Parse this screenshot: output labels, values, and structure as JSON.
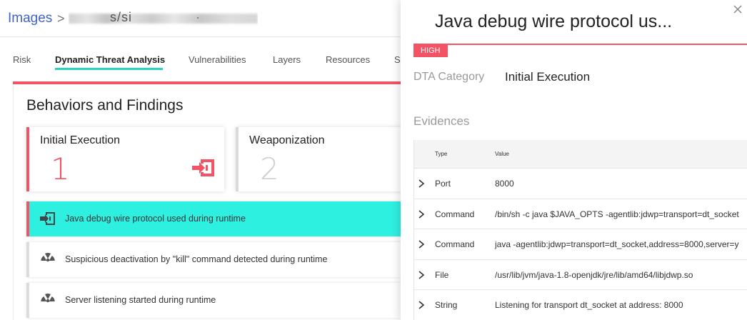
{
  "breadcrumb": {
    "root": "Images",
    "separator": ">",
    "path_fragment": "s/si",
    "path_fragment2": "·"
  },
  "tabs": [
    {
      "label": "Risk"
    },
    {
      "label": "Dynamic Threat Analysis",
      "active": true
    },
    {
      "label": "Vulnerabilities"
    },
    {
      "label": "Layers"
    },
    {
      "label": "Resources"
    },
    {
      "label": "S"
    }
  ],
  "main": {
    "section_title": "Behaviors and Findings",
    "categories": [
      {
        "name": "Initial Execution",
        "count": "1",
        "icon": "enter-icon"
      },
      {
        "name": "Weaponization",
        "count": "2"
      }
    ],
    "findings": [
      {
        "text": "Java debug wire protocol used during runtime",
        "icon": "enter-icon",
        "selected": true
      },
      {
        "text": "Suspicious deactivation by \"kill\" command detected during runtime",
        "icon": "radiation-icon"
      },
      {
        "text": "Server listening started during runtime",
        "icon": "radiation-icon"
      }
    ]
  },
  "panel": {
    "title": "Java debug wire protocol us...",
    "severity": "HIGH",
    "dta_category_label": "DTA Category",
    "dta_category_value": "Initial Execution",
    "evidences_title": "Evidences",
    "columns": {
      "type": "Type",
      "value": "Value"
    },
    "rows": [
      {
        "type": "Port",
        "value": "8000"
      },
      {
        "type": "Command",
        "value": "/bin/sh -c java $JAVA_OPTS -agentlib:jdwp=transport=dt_socket"
      },
      {
        "type": "Command",
        "value": "java -agentlib:jdwp=transport=dt_socket,address=8000,server=y"
      },
      {
        "type": "File",
        "value": "/usr/lib/jvm/java-1.8-openjdk/jre/lib/amd64/libjdwp.so"
      },
      {
        "type": "String",
        "value": "Listening for transport dt_socket at address: 8000"
      }
    ]
  },
  "colors": {
    "accent_red": "#f25465",
    "accent_teal": "#2ef0e1",
    "link_blue": "#3f63c9"
  }
}
